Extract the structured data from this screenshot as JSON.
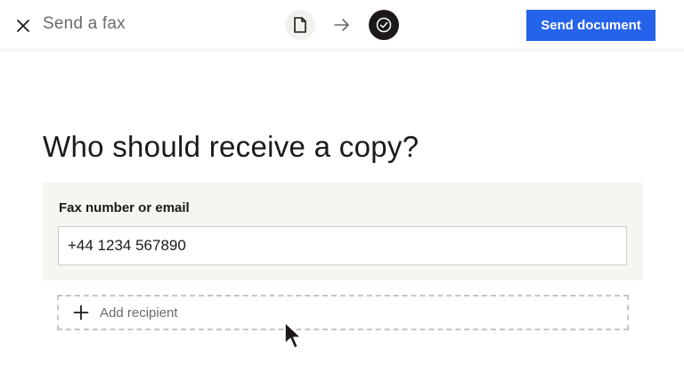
{
  "topbar": {
    "title": "Send a fax",
    "close_icon": "close-icon",
    "steps": [
      {
        "icon": "document-icon",
        "state": "completed"
      },
      {
        "icon": "arrow-right-icon",
        "state": "separator"
      },
      {
        "icon": "check-circle-icon",
        "state": "current"
      }
    ],
    "send_label": "Send document"
  },
  "main": {
    "heading": "Who should receive a copy?",
    "recipient_field": {
      "label": "Fax number or email",
      "value": "+44 1234 567890"
    },
    "add_recipient": {
      "icon": "plus-icon",
      "label": "Add recipient"
    }
  },
  "colors": {
    "accent": "#2563eb",
    "text": "#1e1919",
    "muted_text": "#6d6a66",
    "panel_background": "#f7f5f2",
    "border": "#cfcbc4"
  }
}
